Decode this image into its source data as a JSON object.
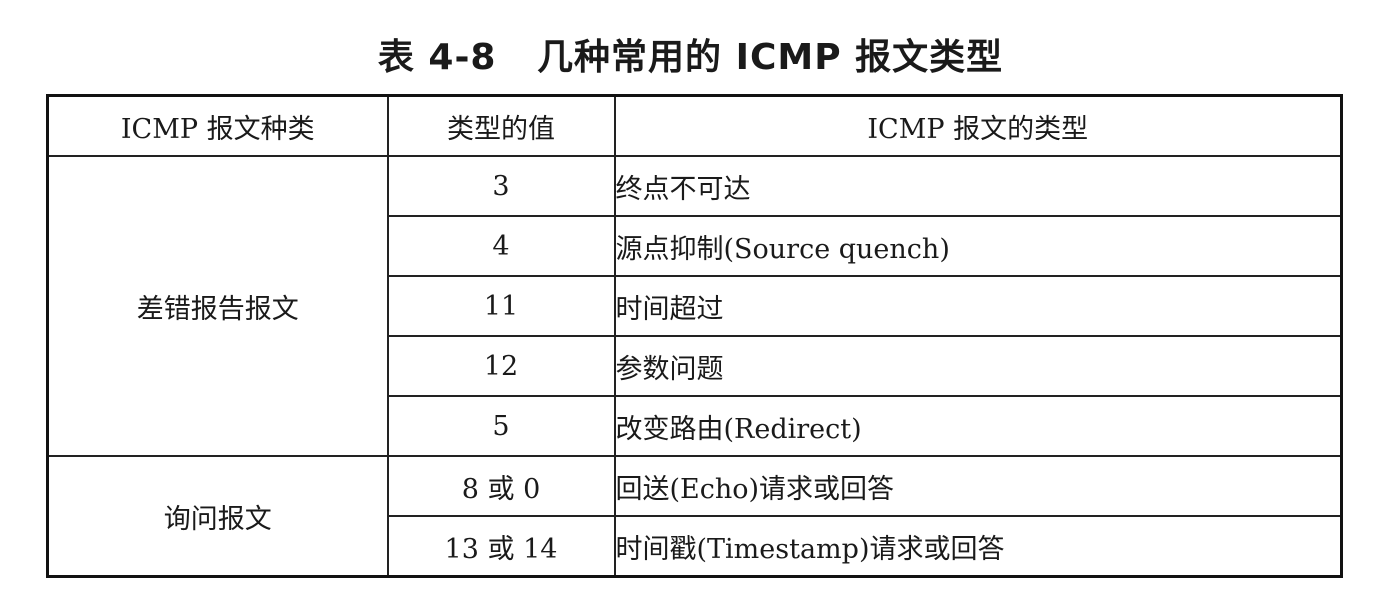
{
  "caption": "表 4-8   几种常用的 ICMP 报文类型",
  "headers": {
    "category": "ICMP  报文种类",
    "value": "类型的值",
    "type": "ICMP 报文的类型"
  },
  "groups": [
    {
      "category": "差错报告报文",
      "rows": [
        {
          "value": "3",
          "type": "终点不可达"
        },
        {
          "value": "4",
          "type": "源点抑制(Source quench)"
        },
        {
          "value": "11",
          "type": "时间超过"
        },
        {
          "value": "12",
          "type": "参数问题"
        },
        {
          "value": "5",
          "type": "改变路由(Redirect)"
        }
      ]
    },
    {
      "category": "询问报文",
      "rows": [
        {
          "value": "8 或 0",
          "type": "回送(Echo)请求或回答"
        },
        {
          "value": "13 或 14",
          "type": "时间戳(Timestamp)请求或回答"
        }
      ]
    }
  ]
}
